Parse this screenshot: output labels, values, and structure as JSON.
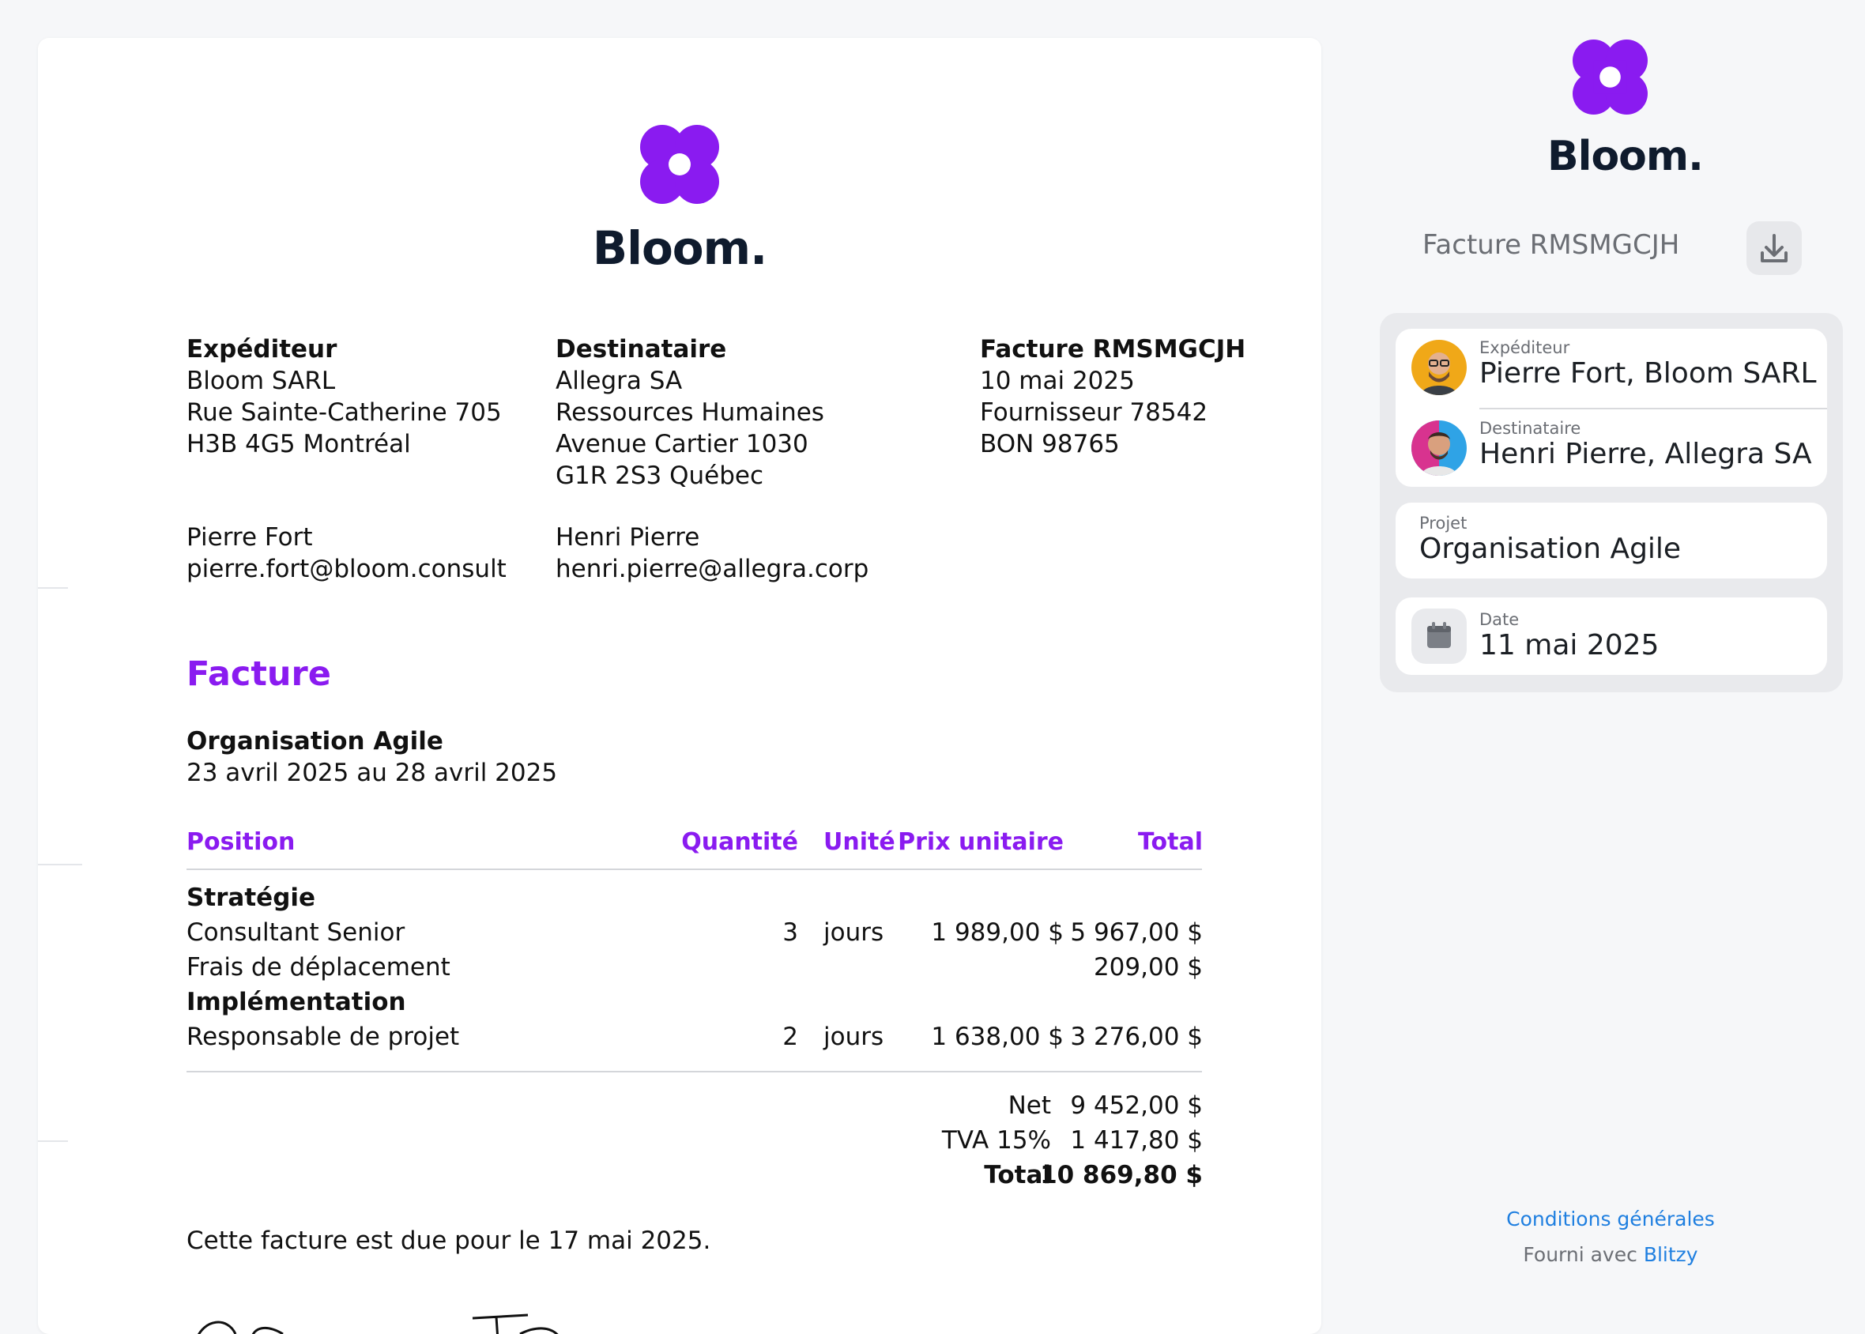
{
  "brand": {
    "name": "Bloom.",
    "color": "#8a1bf0"
  },
  "invoice": {
    "sender": {
      "label": "Expéditeur",
      "lines": [
        "Bloom SARL",
        "Rue Sainte-Catherine 705",
        "H3B 4G5 Montréal"
      ],
      "contact_name": "Pierre Fort",
      "contact_email": "pierre.fort@bloom.consult"
    },
    "recipient": {
      "label": "Destinataire",
      "lines": [
        "Allegra SA",
        "Ressources Humaines",
        "Avenue Cartier 1030",
        "G1R 2S3 Québec"
      ],
      "contact_name": "Henri Pierre",
      "contact_email": "henri.pierre@allegra.corp"
    },
    "meta": {
      "title": "Facture RMSMGCJH",
      "lines": [
        "10 mai 2025",
        "Fournisseur 78542",
        "BON 98765"
      ]
    },
    "heading": "Facture",
    "project": {
      "name": "Organisation Agile",
      "period": "23 avril 2025 au 28 avril 2025"
    },
    "table": {
      "headers": {
        "position": "Position",
        "quantity": "Quantité",
        "unit": "Unité",
        "unit_price": "Prix unitaire",
        "total": "Total"
      },
      "groups": [
        {
          "name": "Stratégie",
          "rows": [
            {
              "position": "Consultant Senior",
              "quantity": "3",
              "unit": "jours",
              "unit_price": "1 989,00 $",
              "total": "5 967,00 $"
            },
            {
              "position": "Frais de déplacement",
              "quantity": "",
              "unit": "",
              "unit_price": "",
              "total": "209,00 $"
            }
          ]
        },
        {
          "name": "Implémentation",
          "rows": [
            {
              "position": "Responsable de projet",
              "quantity": "2",
              "unit": "jours",
              "unit_price": "1 638,00 $",
              "total": "3 276,00 $"
            }
          ]
        }
      ]
    },
    "totals": {
      "net_label": "Net",
      "net": "9 452,00 $",
      "vat_label": "TVA 15%",
      "vat": "1 417,80 $",
      "total_label": "Total",
      "total": "10 869,80 $"
    },
    "due_text": "Cette facture est due pour le 17 mai 2025."
  },
  "sidebar": {
    "brand": "Bloom.",
    "invoice_title": "Facture RMSMGCJH",
    "download_icon": "download-icon",
    "sender": {
      "label": "Expéditeur",
      "value": "Pierre Fort, Bloom SARL"
    },
    "recipient": {
      "label": "Destinataire",
      "value": "Henri Pierre, Allegra SA"
    },
    "project": {
      "label": "Projet",
      "value": "Organisation Agile"
    },
    "date": {
      "label": "Date",
      "value": "11 mai 2025",
      "icon": "calendar-icon"
    },
    "terms_link": "Conditions générales",
    "powered_prefix": "Fourni avec",
    "powered_brand": "Blitzy",
    "link_color": "#1f7fe0"
  }
}
